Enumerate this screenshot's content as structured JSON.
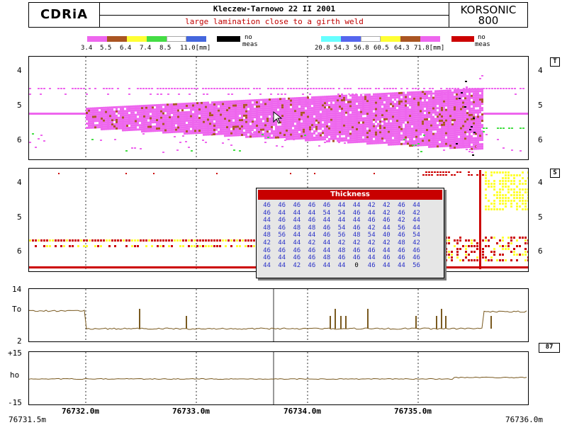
{
  "header": {
    "logo": "CDRiA",
    "title": "Kleczew-Tarnowo 22 II 2001",
    "subtitle": "large lamination close to a girth weld",
    "brand_line1": "KORSONIC",
    "brand_line2": "800"
  },
  "legend_left": {
    "ticks": [
      "3.4",
      "5.5",
      "6.4",
      "7.4",
      "8.5",
      "11.0[mm]"
    ],
    "colors": [
      "#ee66ee",
      "#aa5522",
      "#ffff33",
      "#44dd44",
      "#ffffff",
      "#4466dd"
    ],
    "nomeas_color": "#000000",
    "nomeas_label_1": "no",
    "nomeas_label_2": "meas"
  },
  "legend_right": {
    "ticks": [
      "20.8",
      "54.3",
      "56.8",
      "60.5",
      "64.3",
      "71.8[mm]"
    ],
    "colors": [
      "#66ffff",
      "#5566ee",
      "#ffffff",
      "#ffff33",
      "#aa5522",
      "#ee66ee"
    ],
    "nomeas_color": "#cc0000",
    "nomeas_label_1": "no",
    "nomeas_label_2": "meas"
  },
  "panel_t": {
    "tag": "T",
    "y_ticks": [
      "4",
      "5",
      "6"
    ],
    "y_ticks_right": [
      "4",
      "5",
      "6"
    ]
  },
  "panel_s": {
    "tag": "S",
    "y_ticks": [
      "4",
      "5",
      "6"
    ],
    "y_ticks_right": [
      "4",
      "5",
      "6"
    ]
  },
  "panel_to": {
    "y_max": "14",
    "y_mid": "To",
    "y_min": "2",
    "badge": "87"
  },
  "panel_ho": {
    "y_max": "+15",
    "y_mid": "ho",
    "y_min": "-15"
  },
  "x_axis": {
    "ticks": [
      "76732.0m",
      "76733.0m",
      "76734.0m",
      "76735.0m"
    ],
    "start": "76731.5m",
    "end": "76736.0m"
  },
  "thickness_popup": {
    "title": "Thickness",
    "rows": [
      [
        "46",
        "46",
        "46",
        "46",
        "46",
        "44",
        "44",
        "42",
        "42",
        "46",
        "44"
      ],
      [
        "46",
        "44",
        "44",
        "44",
        "54",
        "54",
        "46",
        "44",
        "42",
        "46",
        "42"
      ],
      [
        "44",
        "46",
        "44",
        "46",
        "44",
        "44",
        "44",
        "46",
        "46",
        "42",
        "44"
      ],
      [
        "48",
        "46",
        "48",
        "48",
        "46",
        "54",
        "46",
        "42",
        "44",
        "56",
        "44"
      ],
      [
        "48",
        "56",
        "44",
        "44",
        "46",
        "56",
        "48",
        "54",
        "40",
        "46",
        "54"
      ],
      [
        "42",
        "44",
        "44",
        "42",
        "44",
        "42",
        "42",
        "42",
        "42",
        "48",
        "42"
      ],
      [
        "46",
        "46",
        "46",
        "46",
        "44",
        "48",
        "46",
        "46",
        "44",
        "46",
        "46"
      ],
      [
        "46",
        "44",
        "46",
        "46",
        "48",
        "46",
        "46",
        "44",
        "46",
        "46",
        "46"
      ],
      [
        "44",
        "44",
        "42",
        "46",
        "44",
        "44",
        "0",
        "46",
        "44",
        "44",
        "56"
      ]
    ]
  },
  "colors": {
    "magenta": "#ee66ee",
    "brown": "#aa5522",
    "yellow": "#ffff33",
    "green": "#44dd44",
    "red": "#cc0000",
    "trace": "#7a5a20"
  }
}
